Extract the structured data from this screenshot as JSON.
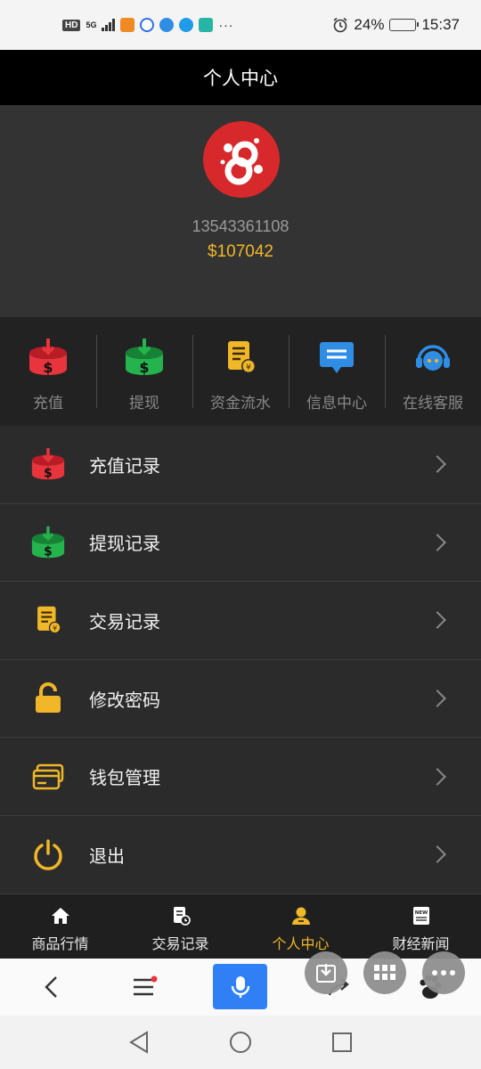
{
  "status_bar": {
    "network_badge": "HD",
    "network_type": "5G",
    "alarm_icon": "alarm-icon",
    "battery_percent": "24%",
    "time": "15:37",
    "more": "···"
  },
  "header": {
    "title": "个人中心"
  },
  "profile": {
    "avatar_icon": "avatar-logo",
    "phone": "13543361108",
    "balance": "$107042"
  },
  "quick_actions": [
    {
      "label": "充值",
      "icon": "deposit-icon",
      "color": "#e8343d"
    },
    {
      "label": "提现",
      "icon": "withdraw-icon",
      "color": "#25b34d"
    },
    {
      "label": "资金流水",
      "icon": "fund-flow-icon",
      "color": "#f0b728"
    },
    {
      "label": "信息中心",
      "icon": "message-icon",
      "color": "#2f8de4"
    },
    {
      "label": "在线客服",
      "icon": "headset-icon",
      "color": "#2f8de4"
    }
  ],
  "menu": [
    {
      "label": "充值记录",
      "icon": "deposit-icon"
    },
    {
      "label": "提现记录",
      "icon": "withdraw-icon"
    },
    {
      "label": "交易记录",
      "icon": "trade-record-icon"
    },
    {
      "label": "修改密码",
      "icon": "lock-icon"
    },
    {
      "label": "钱包管理",
      "icon": "wallet-icon"
    },
    {
      "label": "退出",
      "icon": "power-icon"
    }
  ],
  "tabs": [
    {
      "label": "商品行情",
      "icon": "home-icon",
      "active": false
    },
    {
      "label": "交易记录",
      "icon": "record-icon",
      "active": false
    },
    {
      "label": "个人中心",
      "icon": "user-icon",
      "active": true
    },
    {
      "label": "财经新闻",
      "icon": "news-icon",
      "active": false,
      "badge": "NEW"
    }
  ],
  "colors": {
    "accent": "#f0b728",
    "background": "#2b2b2b",
    "title_bar": "#000000",
    "mic_button": "#2f80f4"
  }
}
